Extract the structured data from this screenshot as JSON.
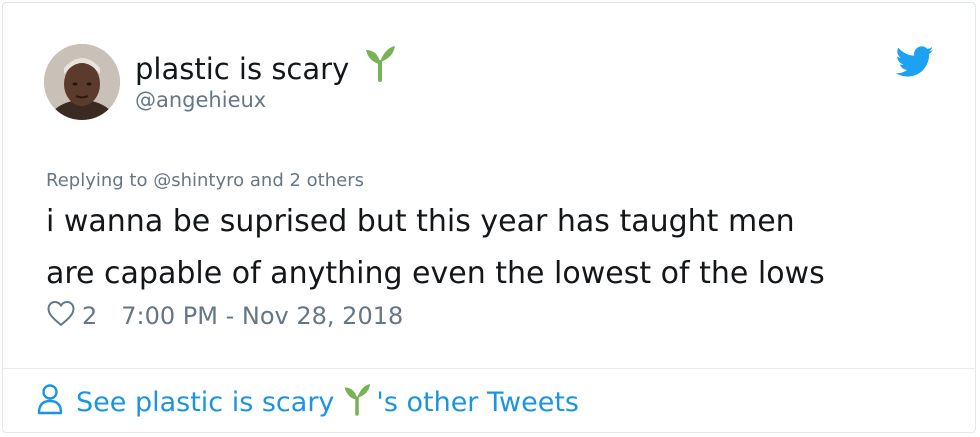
{
  "user": {
    "display_name": "plastic is scary",
    "handle": "@angehieux"
  },
  "tweet": {
    "replying_prefix": "Replying to",
    "replying_target": "@shintyro",
    "replying_suffix": "and 2 others",
    "text_lines": [
      "i wanna be suprised but this year has taught men",
      "are capable of anything even the lowest of the lows"
    ],
    "like_count": "2",
    "timestamp": "7:00 PM - Nov 28, 2018"
  },
  "footer": {
    "prefix": "See plastic is scary",
    "suffix": "'s other Tweets"
  },
  "icons": {
    "sprout": "sprout-icon",
    "bird": "twitter-bird-icon",
    "heart": "heart-icon",
    "person": "person-icon"
  },
  "colors": {
    "link_blue": "#1b95e0",
    "secondary_gray": "#657786",
    "text_dark": "#14171a",
    "sprout_green": "#77b255"
  }
}
